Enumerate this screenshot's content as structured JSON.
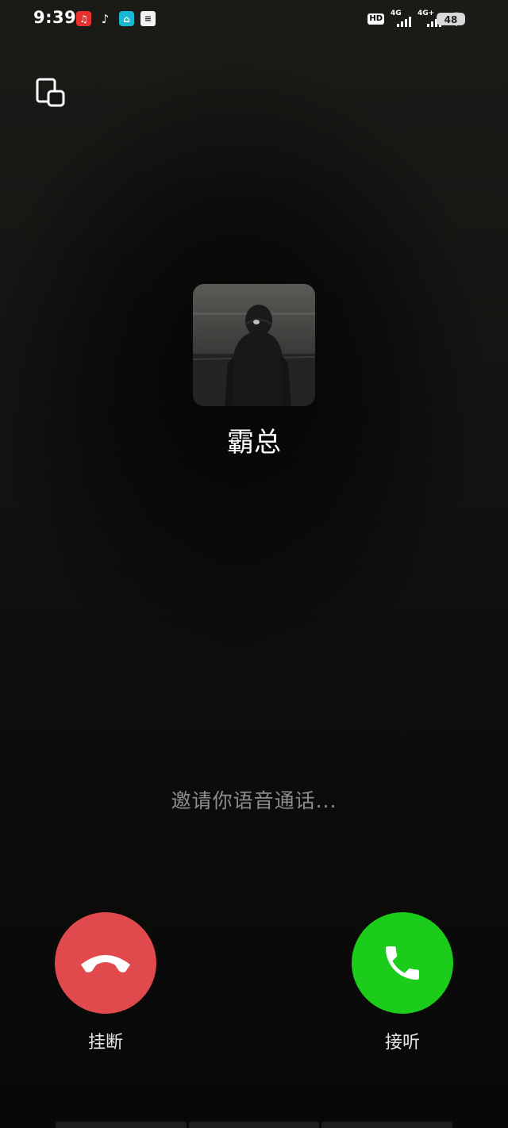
{
  "status_bar": {
    "time": "9:39",
    "notification_icons": [
      "netease-music-icon",
      "tiktok-icon",
      "app-store-icon",
      "document-icon"
    ],
    "hd_label": "HD",
    "signal_1_label": "4G",
    "signal_2_label": "4G+",
    "battery_level": "48"
  },
  "call": {
    "caller_name": "霸总",
    "status_text": "邀请你语音通话...",
    "decline_label": "挂断",
    "accept_label": "接听"
  },
  "colors": {
    "decline": "#e04a4c",
    "accept": "#1bcc1b",
    "status_text": "#8c8c8c"
  }
}
